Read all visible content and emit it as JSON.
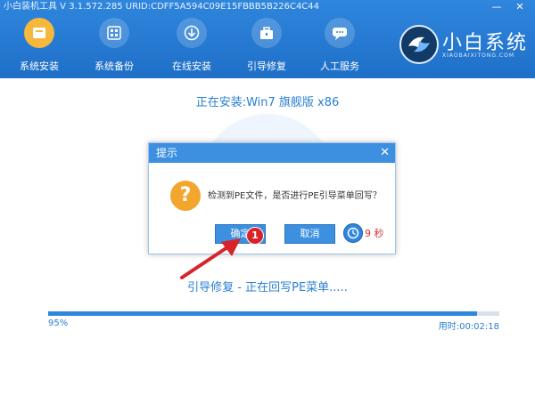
{
  "window": {
    "title": "小白装机工具 V 3.1.572.285 URID:CDFF5A594C09E15FBBB5B226C4C44"
  },
  "nav": {
    "items": [
      {
        "label": "系统安装",
        "icon": "system-install-icon",
        "active": true
      },
      {
        "label": "系统备份",
        "icon": "backup-icon",
        "active": false
      },
      {
        "label": "在线安装",
        "icon": "download-icon",
        "active": false
      },
      {
        "label": "引导修复",
        "icon": "toolbox-icon",
        "active": false
      },
      {
        "label": "人工服务",
        "icon": "chat-icon",
        "active": false
      }
    ]
  },
  "brand": {
    "name": "小白系统",
    "subtitle": "XIAOBAIXITONG.COM"
  },
  "install": {
    "title": "正在安装:Win7 旗舰版 x86"
  },
  "dialog": {
    "title": "提示",
    "message": "检测到PE文件，是否进行PE引导菜单回写？",
    "ok_label": "确定",
    "cancel_label": "取消",
    "countdown": "9 秒"
  },
  "annotation": {
    "step": "1"
  },
  "progress": {
    "status": "引导修复 - 正在回写PE菜单.....",
    "percent_label": "95%",
    "fraction": 0.95,
    "elapsed": "用时:00:02:18"
  },
  "colors": {
    "primary": "#2f86dd",
    "accent": "#f5b73c",
    "countdown": "#d83434",
    "annotation": "#d8232a"
  }
}
